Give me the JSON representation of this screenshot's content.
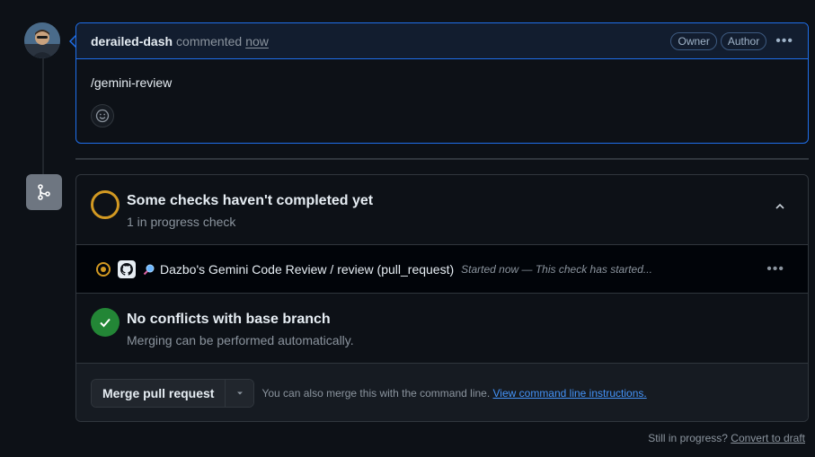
{
  "comment": {
    "author": "derailed-dash",
    "action": "commented",
    "timestamp": "now",
    "badges": [
      "Owner",
      "Author"
    ],
    "body": "/gemini-review"
  },
  "checks": {
    "title": "Some checks haven't completed yet",
    "subtitle": "1 in progress check",
    "items": [
      {
        "name": "Dazbo's Gemini Code Review / review (pull_request)",
        "status": "Started now — This check has started..."
      }
    ]
  },
  "conflicts": {
    "title": "No conflicts with base branch",
    "subtitle": "Merging can be performed automatically."
  },
  "merge": {
    "button_label": "Merge pull request",
    "hint_text": "You can also merge this with the command line.",
    "hint_link": "View command line instructions."
  },
  "footer": {
    "question": "Still in progress?",
    "link": "Convert to draft"
  },
  "colors": {
    "accent": "#1f6feb",
    "pending": "#d29922",
    "success": "#238636",
    "link": "#4493f8"
  }
}
